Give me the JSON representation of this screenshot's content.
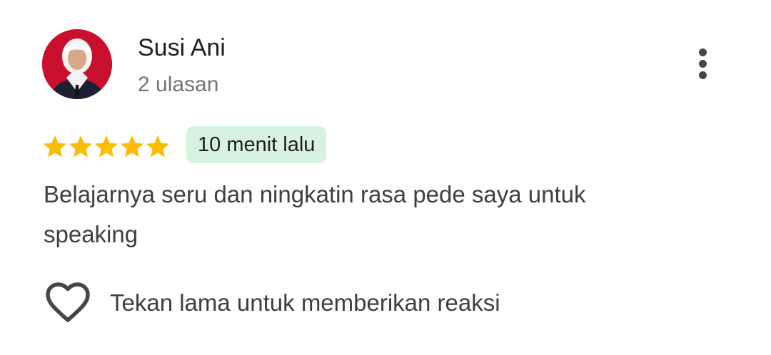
{
  "review": {
    "author": {
      "name": "Susi Ani",
      "review_count": "2 ulasan",
      "avatar_icon": "profile-photo-avatar"
    },
    "rating": {
      "stars": 5,
      "max": 5,
      "star_icon": "star-icon",
      "star_color": "#fbbc04"
    },
    "time_badge": {
      "label": "10 menit lalu",
      "background": "#d7f3df"
    },
    "text_lines": [
      "Belajarnya seru dan ningkatin rasa pede saya untuk",
      "speaking"
    ],
    "more_icon": "more-vert-icon",
    "reaction": {
      "icon": "heart-outline-icon",
      "label": "Tekan lama untuk memberikan reaksi"
    }
  }
}
